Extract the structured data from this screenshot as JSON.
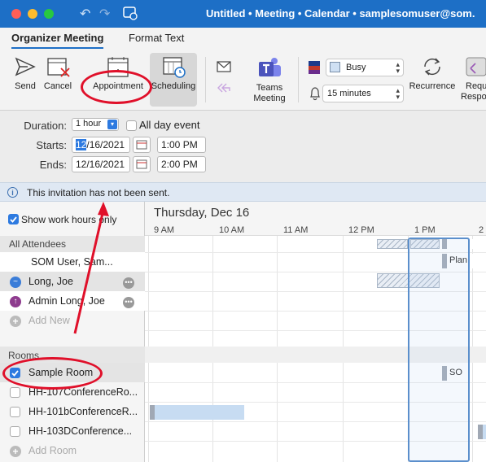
{
  "window": {
    "title": "Untitled • Meeting • Calendar • samplesomuser@som."
  },
  "tabs": [
    {
      "label": "Organizer Meeting"
    },
    {
      "label": "Format Text"
    }
  ],
  "ribbon": {
    "send": "Send",
    "cancel": "Cancel",
    "appointment": "Appointment",
    "scheduling": "Scheduling",
    "teams": "Teams\nMeeting",
    "teams_line1": "Teams",
    "teams_line2": "Meeting",
    "show_as": "Busy",
    "reminder": "15 minutes",
    "recurrence": "Recurrence",
    "request_line1": "Requ",
    "request_line2": "Respo"
  },
  "dates": {
    "duration_label": "Duration:",
    "duration_value": "1 hour",
    "all_day_label": "All day event",
    "starts_label": "Starts:",
    "start_month": "12",
    "start_rest": "/16/2021",
    "start_time": "1:00 PM",
    "ends_label": "Ends:",
    "end_date": "12/16/2021",
    "end_time": "2:00 PM"
  },
  "info": {
    "message": "This invitation has not been sent."
  },
  "scheduler": {
    "show_work_hours": "Show work hours only",
    "day_title": "Thursday, Dec 16",
    "hours": [
      "9 AM",
      "10 AM",
      "11 AM",
      "12 PM",
      "1 PM",
      "2"
    ],
    "attendees_header": "All Attendees",
    "attendees": [
      {
        "name": "SOM User, Sam..."
      },
      {
        "name": "Long, Joe"
      },
      {
        "name": "Admin Long, Joe"
      }
    ],
    "add_new": "Add New",
    "rooms_header": "Rooms",
    "rooms": [
      {
        "name": "Sample Room",
        "checked": true
      },
      {
        "name": "HH-107ConferenceRo...",
        "checked": false
      },
      {
        "name": "HH-101bConferenceR...",
        "checked": false
      },
      {
        "name": "HH-103DConference...",
        "checked": false
      }
    ],
    "add_room": "Add Room",
    "appt_label_plan": "Plan",
    "appt_label_so": "SO"
  },
  "colors": {
    "titlebar": "#1d6fc6",
    "annotation": "#e0102a"
  }
}
